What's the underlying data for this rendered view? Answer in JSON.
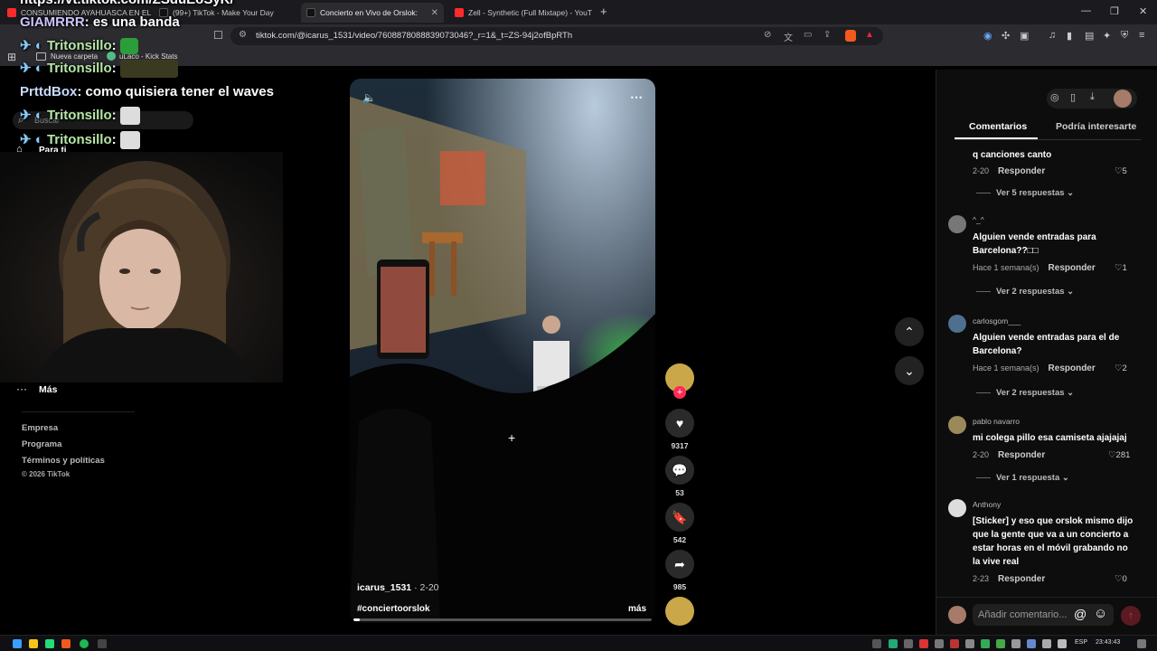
{
  "browser": {
    "tabs": [
      {
        "label": "CONSUMIENDO AYAHUASCA EN EL",
        "color": "#ff2b2b"
      },
      {
        "label": "(99+) TikTok - Make Your Day",
        "color": "#222"
      },
      {
        "label": "Concierto en Vivo de Orslok:",
        "color": "#222"
      },
      {
        "label": "Zell - Synthetic (Full Mixtape) - YouTu",
        "color": "#ff2b2b"
      }
    ],
    "new_tab": "+",
    "url": "tiktok.com/@icarus_1531/video/7608878088839073046?_r=1&_t=ZS-94j2ofBpRTh",
    "bookmarks": [
      "Nueva carpeta",
      "uLaco - Kick Stats"
    ]
  },
  "overlay_chat": {
    "top_url": "https://vt.tiktok.com/ZSduEoSyK/",
    "lines": [
      {
        "user": "GIAMRRR",
        "text": ": es una banda"
      },
      {
        "user": "Tritonsillo",
        "text": ":"
      },
      {
        "user": "Tritonsillo",
        "text": ":"
      },
      {
        "user": "PrttdBox",
        "text": ": como quisiera tener el waves"
      },
      {
        "user": "Tritonsillo",
        "text": ":"
      },
      {
        "user": "Tritonsillo",
        "text": ":"
      }
    ]
  },
  "sidebar": {
    "search_placeholder": "Buscar",
    "for_you": "Para ti",
    "more": "Más",
    "more_dots": "···",
    "links": [
      "Empresa",
      "Programa",
      "Términos y políticas"
    ],
    "copyright": "© 2026 TikTok"
  },
  "video": {
    "author": "icarus_1531",
    "date": "· 2-20",
    "hashtag": "#conciertoorslok",
    "more_label": "más",
    "likes": "9317",
    "comments": "53",
    "saves": "542",
    "shares": "985",
    "progress": 0.02
  },
  "right_panel": {
    "tabs": [
      "Comentarios",
      "Podría interesarte"
    ],
    "comments": [
      {
        "user": "",
        "text": "q canciones canto",
        "date": "2-20",
        "reply_label": "Responder",
        "likes": "5",
        "replies": "Ver 5 respuestas"
      },
      {
        "user": "^_^",
        "text": "Alguien vende entradas para Barcelona??□□",
        "date": "Hace 1 semana(s)",
        "reply_label": "Responder",
        "likes": "1",
        "replies": "Ver 2 respuestas"
      },
      {
        "user": "carlosgom___",
        "text": "Alguien vende entradas para el de Barcelona?",
        "date": "Hace 1 semana(s)",
        "reply_label": "Responder",
        "likes": "2",
        "replies": "Ver 2 respuestas"
      },
      {
        "user": "pablo navarro",
        "text": "mi colega pillo esa camiseta ajajajaj",
        "date": "2-20",
        "reply_label": "Responder",
        "likes": "281",
        "replies": "Ver 1 respuesta"
      },
      {
        "user": "Anthony",
        "text": "[Sticker] y eso que orslok mismo dijo que la gente que va a un concierto a estar horas en el móvil grabando no la vive real",
        "date": "2-23",
        "reply_label": "Responder",
        "likes": "0",
        "replies": ""
      }
    ],
    "comment_placeholder": "Añadir comentario...",
    "at_icon": "@",
    "emoji_icon": "☺"
  },
  "taskbar": {
    "lang": "ESP",
    "time": "23:43:43"
  }
}
